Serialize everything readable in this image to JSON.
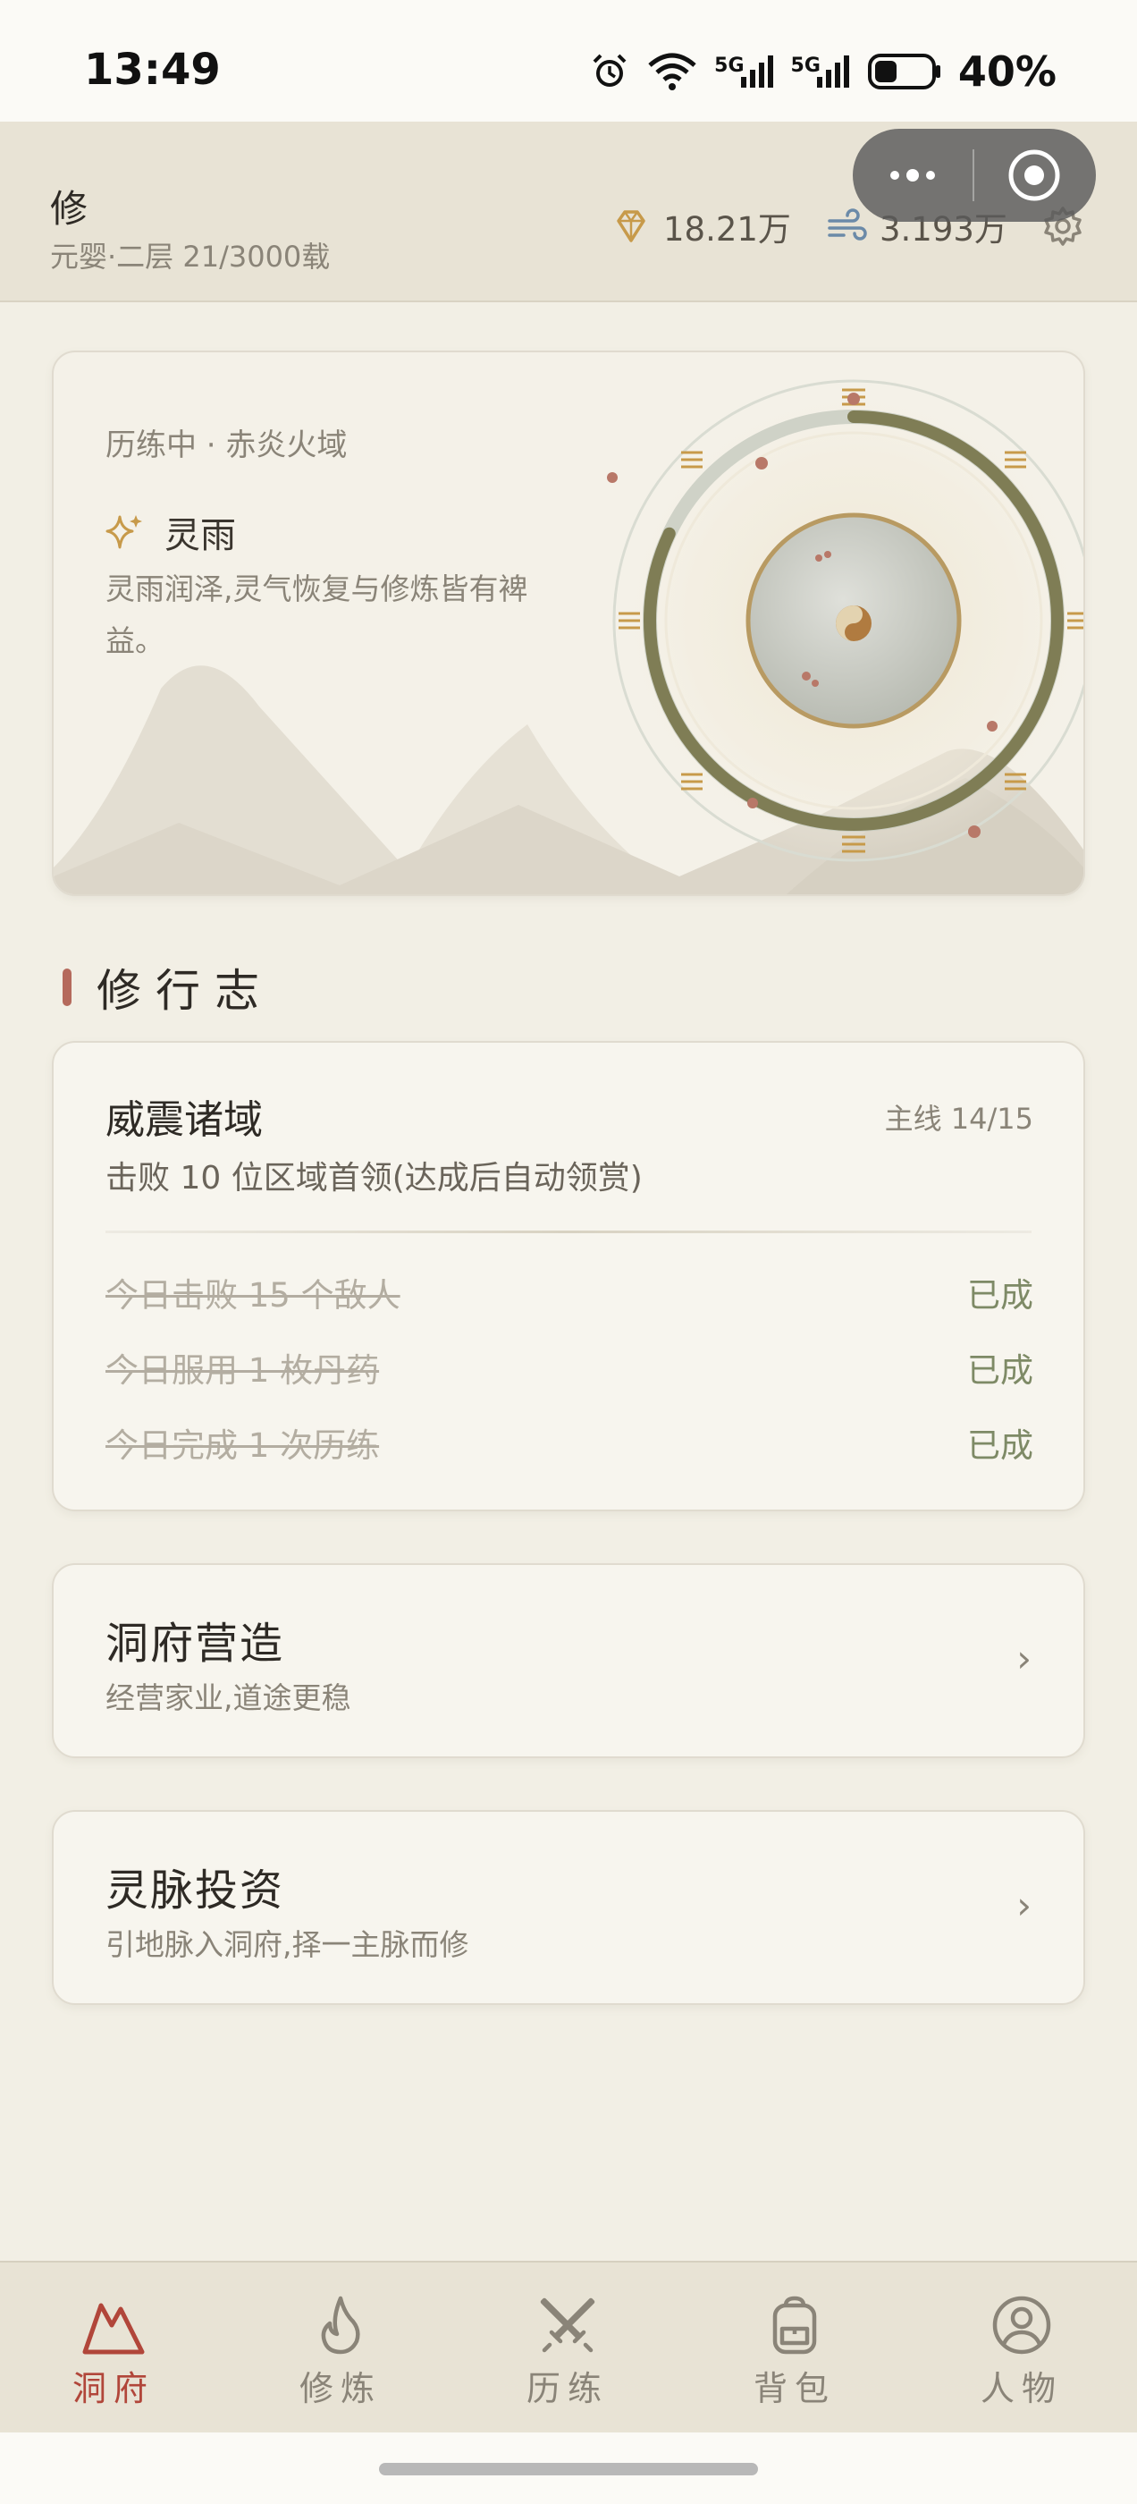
{
  "status_bar": {
    "time": "13:49",
    "network_1": "5G",
    "network_2": "5G",
    "battery": "40%",
    "battery_level": 0.4,
    "icons": [
      "alarm-icon",
      "wifi-icon",
      "signal-icon",
      "signal-icon",
      "battery-icon"
    ]
  },
  "header": {
    "name": "修",
    "realm": "元婴·二层 21/3000载",
    "spirit_stones": "18.21万",
    "qi": "3.193万",
    "colors": {
      "gem": "#c79a4a",
      "wind": "#6b8aa8"
    }
  },
  "status_card": {
    "activity": "历练中 · 赤炎火域",
    "weather_name": "灵雨",
    "weather_desc": "灵雨润泽,灵气恢复与修炼皆有裨益。",
    "orb_progress": 0.82
  },
  "journal": {
    "section_title": "修行志",
    "main_quest": {
      "title": "威震诸域",
      "progress": "主线 14/15",
      "desc": "击败 10 位区域首领(达成后自动领赏)"
    },
    "dailies": [
      {
        "text": "今日击败 15 个敌人",
        "status": "已成"
      },
      {
        "text": "今日服用 1 枚丹药",
        "status": "已成"
      },
      {
        "text": "今日完成 1 次历练",
        "status": "已成"
      }
    ]
  },
  "nav_cards": [
    {
      "title": "洞府营造",
      "subtitle": "经营家业,道途更稳",
      "chevron": "›"
    },
    {
      "title": "灵脉投资",
      "subtitle": "引地脉入洞府,择一主脉而修",
      "chevron": "›"
    }
  ],
  "tabs": [
    {
      "label": "洞府",
      "icon": "mountain-icon",
      "active": true
    },
    {
      "label": "修炼",
      "icon": "flame-icon",
      "active": false
    },
    {
      "label": "历练",
      "icon": "crossed-swords-icon",
      "active": false
    },
    {
      "label": "背包",
      "icon": "backpack-icon",
      "active": false
    },
    {
      "label": "人物",
      "icon": "person-icon",
      "active": false
    }
  ],
  "accent_color": "#b1463a"
}
